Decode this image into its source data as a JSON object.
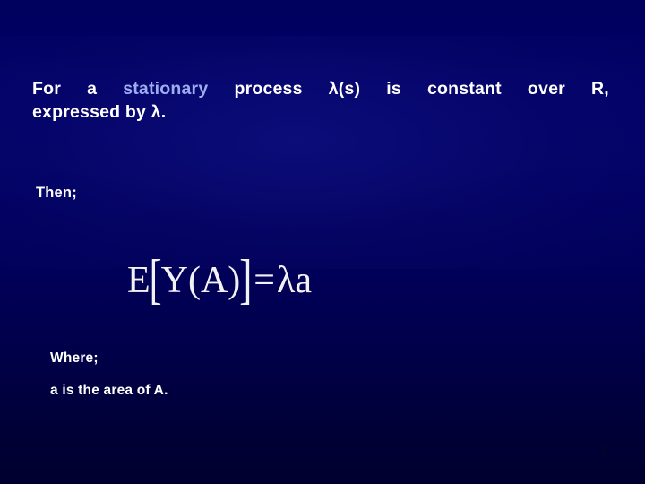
{
  "slide": {
    "background_top_color": "#00005e",
    "background_mid_color": "#010168",
    "background_bottom_color": "#00002e",
    "text_color": "#ffffff",
    "accent_color": "#9dadf0",
    "formula_color": "#f2f2f2"
  },
  "body": {
    "paragraph": {
      "line1_part1": "For",
      "line1_part2": "a",
      "line1_accent": "stationary",
      "line1_part3": "process",
      "line1_part4": "λ(s)",
      "line1_part5": "is",
      "line1_part6": "constant",
      "line1_part7": "over",
      "line1_part8": "R,",
      "line2": "expressed by λ."
    },
    "then_label": "Then;",
    "formula": {
      "full_text": "E[Y(A)] = λa",
      "lhs_fn": "E",
      "bracket_open": "[",
      "inner": "Y(A)",
      "bracket_close": "]",
      "equals": "=",
      "lambda": "λ",
      "area_symbol": "a"
    },
    "where_label": "Where;",
    "area_definition": "a is the area of A."
  },
  "footer": {
    "page_number": "3"
  }
}
